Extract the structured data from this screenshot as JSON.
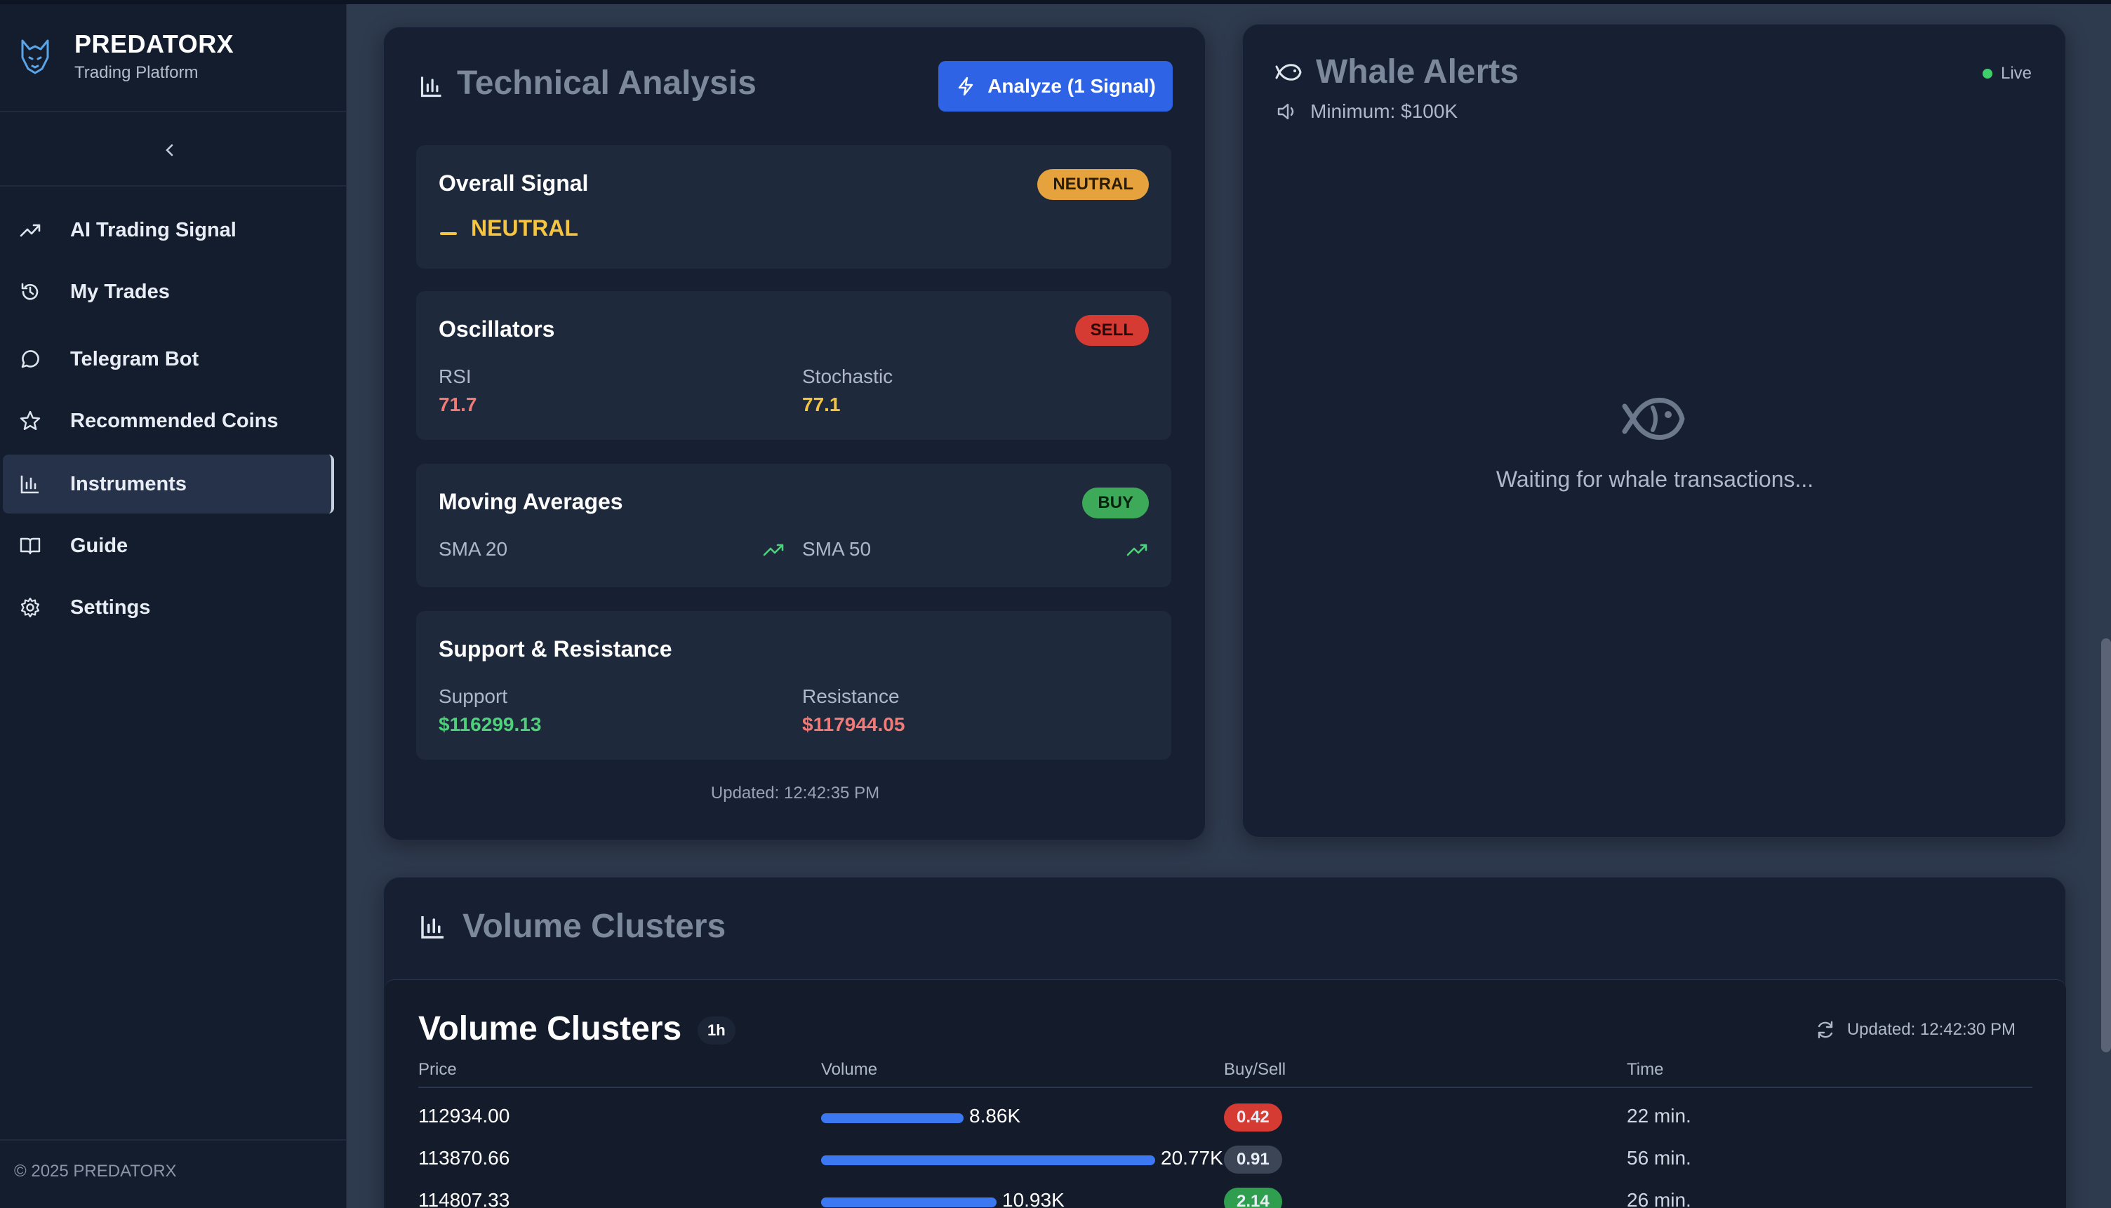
{
  "brand": {
    "title": "PREDATORX",
    "subtitle": "Trading Platform"
  },
  "sidebar": {
    "items": [
      {
        "label": "AI Trading Signal",
        "icon": "trending-up-icon"
      },
      {
        "label": "My Trades",
        "icon": "history-icon"
      },
      {
        "label": "Telegram Bot",
        "icon": "chat-bubble-icon"
      },
      {
        "label": "Recommended Coins",
        "icon": "star-icon"
      },
      {
        "label": "Instruments",
        "icon": "bar-chart-icon",
        "active": true
      },
      {
        "label": "Guide",
        "icon": "book-icon"
      },
      {
        "label": "Settings",
        "icon": "gear-icon"
      }
    ],
    "copyright": "© 2025 PREDATORX"
  },
  "technical": {
    "title": "Technical Analysis",
    "analyze_label": "Analyze (1 Signal)",
    "overall": {
      "title": "Overall Signal",
      "badge": "NEUTRAL",
      "value": "NEUTRAL"
    },
    "oscillators": {
      "title": "Oscillators",
      "badge": "SELL",
      "rsi_label": "RSI",
      "rsi_value": "71.7",
      "stoch_label": "Stochastic",
      "stoch_value": "77.1"
    },
    "moving_averages": {
      "title": "Moving Averages",
      "badge": "BUY",
      "sma20_label": "SMA 20",
      "sma50_label": "SMA 50"
    },
    "support_resistance": {
      "title": "Support & Resistance",
      "support_label": "Support",
      "support_value": "$116299.13",
      "resistance_label": "Resistance",
      "resistance_value": "$117944.05"
    },
    "updated": "Updated: 12:42:35 PM"
  },
  "whale": {
    "title": "Whale Alerts",
    "live_label": "Live",
    "minimum": "Minimum: $100K",
    "waiting": "Waiting for whale transactions..."
  },
  "volume": {
    "card_title": "Volume Clusters",
    "inner_title": "Volume Clusters",
    "interval": "1h",
    "updated": "Updated: 12:42:30 PM",
    "headers": {
      "price": "Price",
      "volume": "Volume",
      "buysell": "Buy/Sell",
      "time": "Time"
    },
    "rows": [
      {
        "price": "112934.00",
        "volume": "8.86K",
        "volume_value": 8.86,
        "ratio": "0.42",
        "ratio_color": "#d63b33",
        "time": "22 min."
      },
      {
        "price": "113870.66",
        "volume": "20.77K",
        "volume_value": 20.77,
        "ratio": "0.91",
        "ratio_color": "#3c4556",
        "time": "56 min."
      },
      {
        "price": "114807.33",
        "volume": "10.93K",
        "volume_value": 10.93,
        "ratio": "2.14",
        "ratio_color": "#2f9e4f",
        "time": "26 min."
      }
    ]
  },
  "colors": {
    "accent": "#2f63e6",
    "neutral": "#e6a23c",
    "sell": "#d63b33",
    "buy": "#3daa5a",
    "red_text": "#f07a75",
    "green_text": "#4fd17c",
    "yellow_text": "#f5c542"
  }
}
